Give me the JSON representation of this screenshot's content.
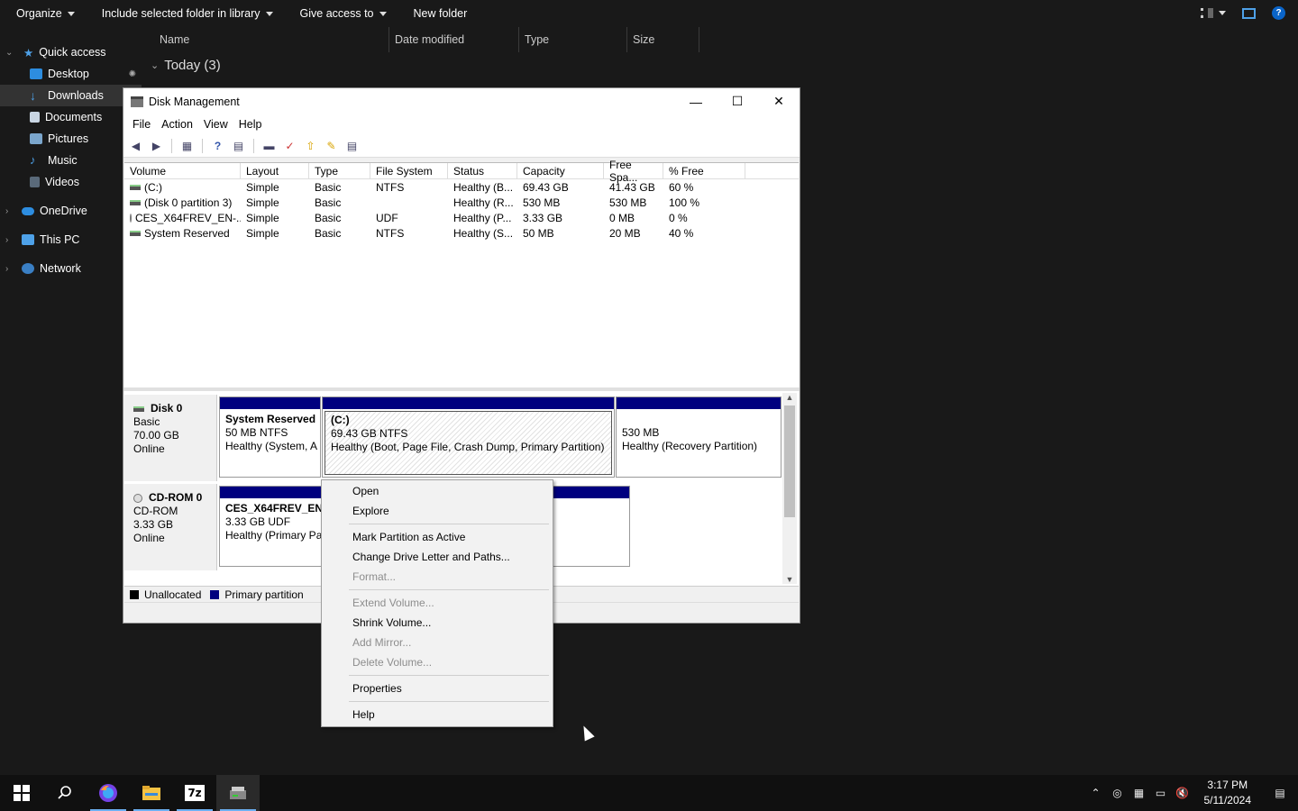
{
  "explorer": {
    "toolbar": {
      "organize": "Organize",
      "include": "Include selected folder in library",
      "give_access": "Give access to",
      "new_folder": "New folder"
    },
    "nav": {
      "quick_access": "Quick access",
      "desktop": "Desktop",
      "downloads": "Downloads",
      "documents": "Documents",
      "pictures": "Pictures",
      "music": "Music",
      "videos": "Videos",
      "onedrive": "OneDrive",
      "this_pc": "This PC",
      "network": "Network"
    },
    "columns": {
      "name": "Name",
      "date": "Date modified",
      "type": "Type",
      "size": "Size"
    },
    "group": "Today (3)"
  },
  "dm": {
    "title": "Disk Management",
    "menu": {
      "file": "File",
      "action": "Action",
      "view": "View",
      "help": "Help"
    },
    "headers": {
      "volume": "Volume",
      "layout": "Layout",
      "type": "Type",
      "fs": "File System",
      "status": "Status",
      "capacity": "Capacity",
      "free": "Free Spa...",
      "pct": "% Free"
    },
    "rows": [
      {
        "volume": "(C:)",
        "layout": "Simple",
        "type": "Basic",
        "fs": "NTFS",
        "status": "Healthy (B...",
        "capacity": "69.43 GB",
        "free": "41.43 GB",
        "pct": "60 %"
      },
      {
        "volume": "(Disk 0 partition 3)",
        "layout": "Simple",
        "type": "Basic",
        "fs": "",
        "status": "Healthy (R...",
        "capacity": "530 MB",
        "free": "530 MB",
        "pct": "100 %"
      },
      {
        "volume": "CES_X64FREV_EN-...",
        "layout": "Simple",
        "type": "Basic",
        "fs": "UDF",
        "status": "Healthy (P...",
        "capacity": "3.33 GB",
        "free": "0 MB",
        "pct": "0 %"
      },
      {
        "volume": "System Reserved",
        "layout": "Simple",
        "type": "Basic",
        "fs": "NTFS",
        "status": "Healthy (S...",
        "capacity": "50 MB",
        "free": "20 MB",
        "pct": "40 %"
      }
    ],
    "disk0": {
      "name": "Disk 0",
      "kind": "Basic",
      "size": "70.00 GB",
      "state": "Online",
      "p1": {
        "name": "System Reserved",
        "size": "50 MB NTFS",
        "status": "Healthy (System, A"
      },
      "p2": {
        "name": "(C:)",
        "size": "69.43 GB NTFS",
        "status": "Healthy (Boot, Page File, Crash Dump, Primary Partition)"
      },
      "p3": {
        "size": "530 MB",
        "status": "Healthy (Recovery Partition)"
      }
    },
    "cdrom0": {
      "name": "CD-ROM 0",
      "kind": "CD-ROM",
      "size": "3.33 GB",
      "state": "Online",
      "p1": {
        "name": "CES_X64FREV_EN-U",
        "size": "3.33 GB UDF",
        "status": "Healthy (Primary Pa"
      }
    },
    "legend": {
      "unallocated": "Unallocated",
      "primary": "Primary partition"
    },
    "colors": {
      "primary": "#00007f",
      "unallocated": "#000000"
    }
  },
  "context_menu": {
    "open": "Open",
    "explore": "Explore",
    "mark_active": "Mark Partition as Active",
    "change_letter": "Change Drive Letter and Paths...",
    "format": "Format...",
    "extend": "Extend Volume...",
    "shrink": "Shrink Volume...",
    "add_mirror": "Add Mirror...",
    "delete": "Delete Volume...",
    "properties": "Properties",
    "help": "Help"
  },
  "taskbar": {
    "time": "3:17 PM",
    "date": "5/11/2024",
    "sevenzip": "7z"
  }
}
